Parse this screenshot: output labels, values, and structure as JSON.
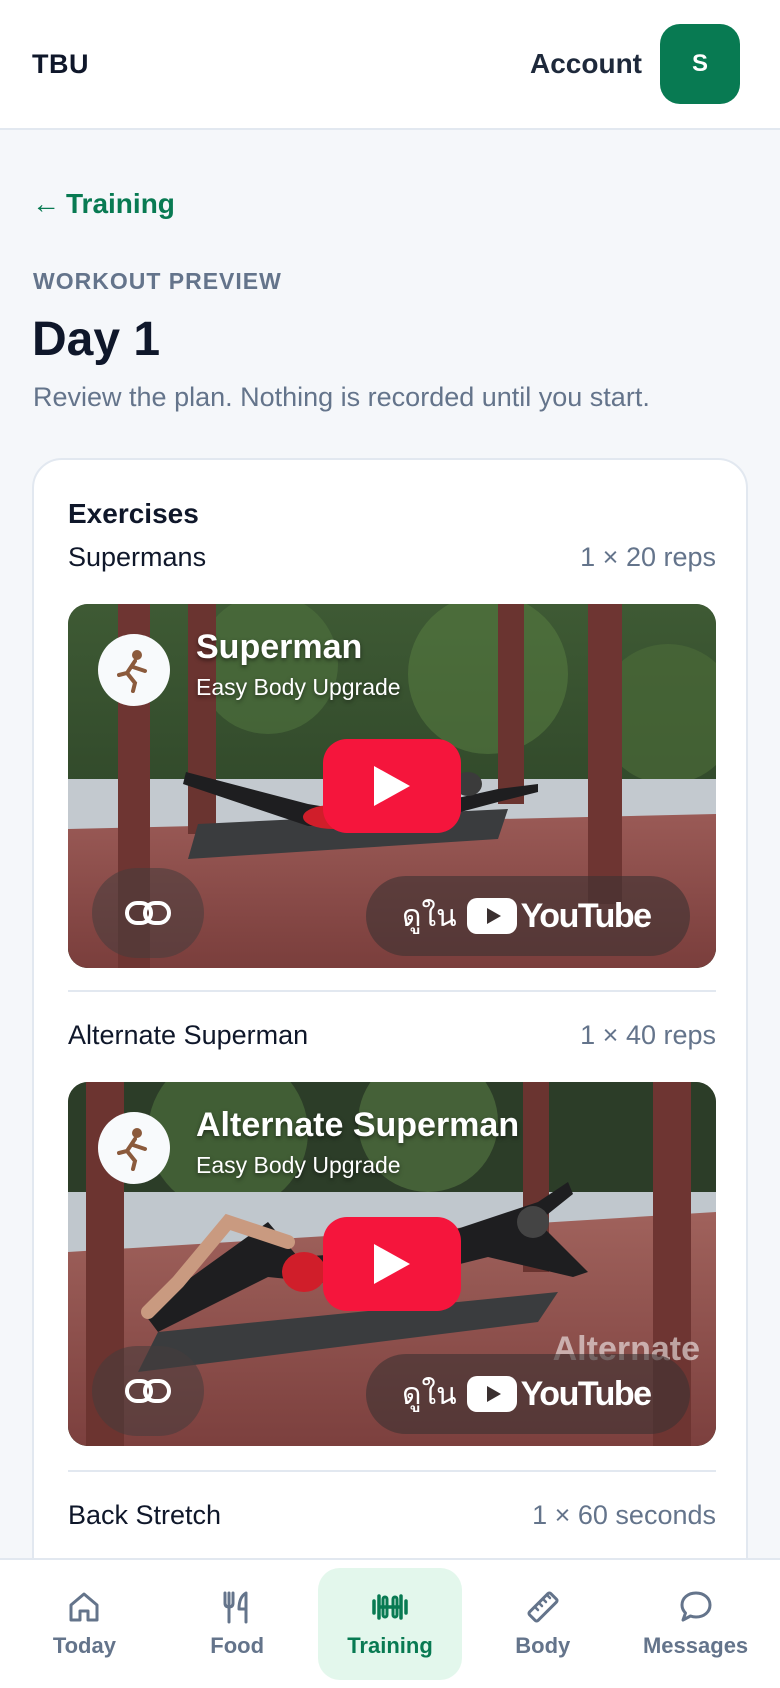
{
  "header": {
    "brand": "TBU",
    "account_label": "Account",
    "avatar_initial": "S"
  },
  "nav_back": {
    "arrow": "←",
    "label": "Training"
  },
  "page": {
    "eyebrow": "WORKOUT PREVIEW",
    "title": "Day 1",
    "subtitle": "Review the plan. Nothing is recorded until you start."
  },
  "exercises_card": {
    "title": "Exercises",
    "items": [
      {
        "name": "Supermans",
        "detail": "1 × 20 reps",
        "video": {
          "title": "Superman",
          "channel": "Easy Body Upgrade",
          "watch_label": "ดูใน",
          "platform": "YouTube"
        }
      },
      {
        "name": "Alternate Superman",
        "detail": "1 × 40 reps",
        "video": {
          "title": "Alternate Superman",
          "channel": "Easy Body Upgrade",
          "watch_label": "ดูใน",
          "platform": "YouTube"
        }
      },
      {
        "name": "Back Stretch",
        "detail": "1 × 60 seconds"
      }
    ]
  },
  "bottom_nav": [
    {
      "label": "Today",
      "icon": "home-icon",
      "active": false
    },
    {
      "label": "Food",
      "icon": "fork-knife-icon",
      "active": false
    },
    {
      "label": "Training",
      "icon": "dumbbell-icon",
      "active": true
    },
    {
      "label": "Body",
      "icon": "ruler-icon",
      "active": false
    },
    {
      "label": "Messages",
      "icon": "chat-bubble-icon",
      "active": false
    }
  ],
  "colors": {
    "brand_green": "#087a52",
    "active_bg": "#e3f7ec",
    "youtube_red": "#f5153c"
  }
}
